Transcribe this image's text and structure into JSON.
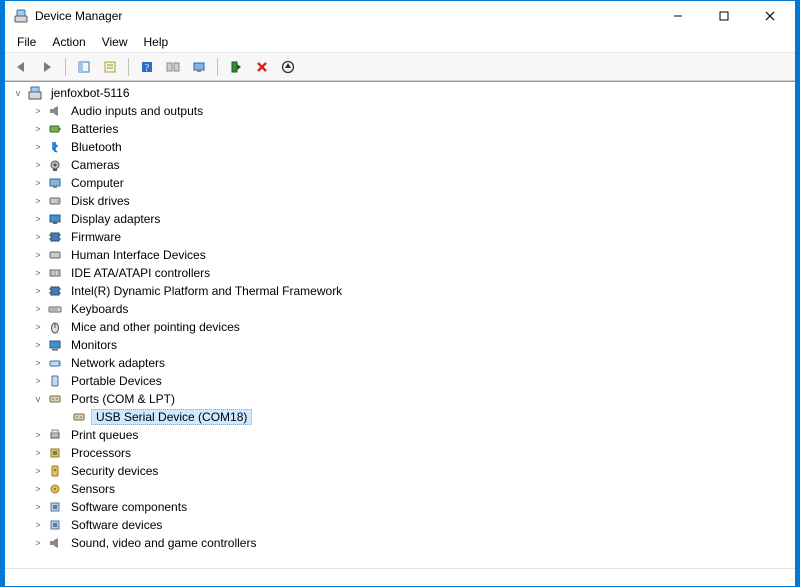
{
  "window": {
    "title": "Device Manager"
  },
  "menu": {
    "file": "File",
    "action": "Action",
    "view": "View",
    "help": "Help"
  },
  "tree": {
    "root": {
      "label": "jenfoxbot-5116",
      "expander": "v"
    },
    "items": [
      {
        "label": "Audio inputs and outputs",
        "expander": ">",
        "icon": "speaker"
      },
      {
        "label": "Batteries",
        "expander": ">",
        "icon": "battery"
      },
      {
        "label": "Bluetooth",
        "expander": ">",
        "icon": "bluetooth"
      },
      {
        "label": "Cameras",
        "expander": ">",
        "icon": "camera"
      },
      {
        "label": "Computer",
        "expander": ">",
        "icon": "computer"
      },
      {
        "label": "Disk drives",
        "expander": ">",
        "icon": "disk"
      },
      {
        "label": "Display adapters",
        "expander": ">",
        "icon": "display"
      },
      {
        "label": "Firmware",
        "expander": ">",
        "icon": "chip"
      },
      {
        "label": "Human Interface Devices",
        "expander": ">",
        "icon": "hid"
      },
      {
        "label": "IDE ATA/ATAPI controllers",
        "expander": ">",
        "icon": "ide"
      },
      {
        "label": "Intel(R) Dynamic Platform and Thermal Framework",
        "expander": ">",
        "icon": "chip"
      },
      {
        "label": "Keyboards",
        "expander": ">",
        "icon": "keyboard"
      },
      {
        "label": "Mice and other pointing devices",
        "expander": ">",
        "icon": "mouse"
      },
      {
        "label": "Monitors",
        "expander": ">",
        "icon": "monitor"
      },
      {
        "label": "Network adapters",
        "expander": ">",
        "icon": "network"
      },
      {
        "label": "Portable Devices",
        "expander": ">",
        "icon": "portable"
      },
      {
        "label": "Ports (COM & LPT)",
        "expander": "v",
        "icon": "port",
        "children": [
          {
            "label": "USB Serial Device (COM18)",
            "icon": "port",
            "selected": true
          }
        ]
      },
      {
        "label": "Print queues",
        "expander": ">",
        "icon": "printer"
      },
      {
        "label": "Processors",
        "expander": ">",
        "icon": "cpu"
      },
      {
        "label": "Security devices",
        "expander": ">",
        "icon": "security"
      },
      {
        "label": "Sensors",
        "expander": ">",
        "icon": "sensor"
      },
      {
        "label": "Software components",
        "expander": ">",
        "icon": "component"
      },
      {
        "label": "Software devices",
        "expander": ">",
        "icon": "component"
      },
      {
        "label": "Sound, video and game controllers",
        "expander": ">",
        "icon": "speaker"
      }
    ]
  }
}
